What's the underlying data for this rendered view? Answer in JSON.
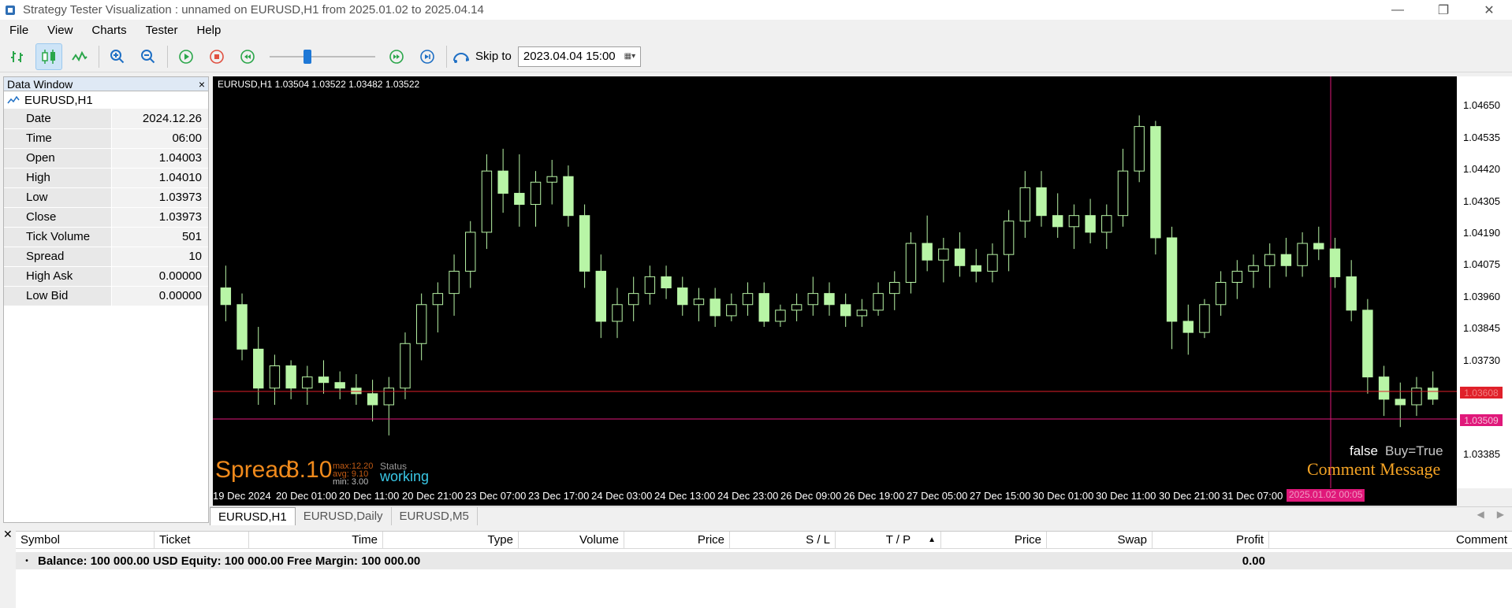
{
  "window": {
    "title": "Strategy Tester Visualization : unnamed on EURUSD,H1 from 2025.01.02 to 2025.04.14",
    "controls": [
      "—",
      "❐",
      "✕"
    ]
  },
  "menu": [
    "File",
    "View",
    "Charts",
    "Tester",
    "Help"
  ],
  "toolbar": {
    "buttons": [
      "bar-chart-icon",
      "candlestick-icon",
      "line-chart-icon",
      "zoom-in-icon",
      "zoom-out-icon",
      "play-icon",
      "stop-icon",
      "rewind-icon",
      "fast-forward-icon",
      "skip-end-icon"
    ],
    "slider_position": 0.35,
    "skip_label": "Skip to",
    "skip_value": "2023.04.04 15:00"
  },
  "data_window": {
    "title": "Data Window",
    "close": "×",
    "symbol": "EURUSD,H1",
    "rows": [
      {
        "k": "Date",
        "v": "2024.12.26"
      },
      {
        "k": "Time",
        "v": "06:00"
      },
      {
        "k": "Open",
        "v": "1.04003"
      },
      {
        "k": "High",
        "v": "1.04010"
      },
      {
        "k": "Low",
        "v": "1.03973"
      },
      {
        "k": "Close",
        "v": "1.03973"
      },
      {
        "k": "Tick Volume",
        "v": "501"
      },
      {
        "k": "Spread",
        "v": "10"
      },
      {
        "k": "High Ask",
        "v": "0.00000"
      },
      {
        "k": "Low Bid",
        "v": "0.00000"
      }
    ]
  },
  "chart": {
    "info": "EURUSD,H1  1.03504 1.03522 1.03482 1.03522",
    "y_ticks": [
      "1.04650",
      "1.04535",
      "1.04420",
      "1.04305",
      "1.04190",
      "1.04075",
      "1.03960",
      "1.03845",
      "1.03730",
      "1.03385"
    ],
    "x_ticks": [
      "19 Dec 2024",
      "20 Dec 01:00",
      "20 Dec 11:00",
      "20 Dec 21:00",
      "23 Dec 07:00",
      "23 Dec 17:00",
      "24 Dec 03:00",
      "24 Dec 13:00",
      "24 Dec 23:00",
      "26 Dec 09:00",
      "26 Dec 19:00",
      "27 Dec 05:00",
      "27 Dec 15:00",
      "30 Dec 01:00",
      "30 Dec 11:00",
      "30 Dec 21:00",
      "31 Dec 07:00"
    ],
    "cursor_time": "2025.01.02 00:05",
    "price_red": "1.03608",
    "price_pink": "1.03509",
    "colors": {
      "bg": "#000000",
      "candle": "#b8f5a6",
      "red_line": "#e0202a",
      "pink": "#e0187a"
    },
    "spread": {
      "label": "Spread",
      "value": "8.10",
      "max": "max:12.20",
      "avg": "avg: 9.10",
      "min": "min: 3.00"
    },
    "status_label": "Status",
    "status_value": "working",
    "buy_false": "false",
    "buy_true": "Buy=True",
    "comment": "Comment Message"
  },
  "chart_data": {
    "type": "candlestick",
    "xlabel": "",
    "ylabel": "",
    "ylim": [
      1.0326,
      1.0474
    ],
    "candles": [
      {
        "o": 1.0398,
        "h": 1.0406,
        "l": 1.0386,
        "c": 1.0392
      },
      {
        "o": 1.0392,
        "h": 1.0396,
        "l": 1.0372,
        "c": 1.0376
      },
      {
        "o": 1.0376,
        "h": 1.0384,
        "l": 1.0356,
        "c": 1.0362
      },
      {
        "o": 1.0362,
        "h": 1.0374,
        "l": 1.0356,
        "c": 1.037
      },
      {
        "o": 1.037,
        "h": 1.0372,
        "l": 1.0358,
        "c": 1.0362
      },
      {
        "o": 1.0362,
        "h": 1.037,
        "l": 1.0356,
        "c": 1.0366
      },
      {
        "o": 1.0366,
        "h": 1.0372,
        "l": 1.036,
        "c": 1.0364
      },
      {
        "o": 1.0364,
        "h": 1.0368,
        "l": 1.0358,
        "c": 1.0362
      },
      {
        "o": 1.0362,
        "h": 1.0367,
        "l": 1.0356,
        "c": 1.036
      },
      {
        "o": 1.036,
        "h": 1.0365,
        "l": 1.035,
        "c": 1.0356
      },
      {
        "o": 1.0356,
        "h": 1.0366,
        "l": 1.0345,
        "c": 1.0362
      },
      {
        "o": 1.0362,
        "h": 1.0382,
        "l": 1.0358,
        "c": 1.0378
      },
      {
        "o": 1.0378,
        "h": 1.0396,
        "l": 1.0372,
        "c": 1.0392
      },
      {
        "o": 1.0392,
        "h": 1.04,
        "l": 1.0382,
        "c": 1.0396
      },
      {
        "o": 1.0396,
        "h": 1.041,
        "l": 1.0388,
        "c": 1.0404
      },
      {
        "o": 1.0404,
        "h": 1.0422,
        "l": 1.0398,
        "c": 1.0418
      },
      {
        "o": 1.0418,
        "h": 1.0446,
        "l": 1.0412,
        "c": 1.044
      },
      {
        "o": 1.044,
        "h": 1.0448,
        "l": 1.0425,
        "c": 1.0432
      },
      {
        "o": 1.0432,
        "h": 1.0446,
        "l": 1.042,
        "c": 1.0428
      },
      {
        "o": 1.0428,
        "h": 1.044,
        "l": 1.042,
        "c": 1.0436
      },
      {
        "o": 1.0436,
        "h": 1.0444,
        "l": 1.0428,
        "c": 1.0438
      },
      {
        "o": 1.0438,
        "h": 1.0442,
        "l": 1.042,
        "c": 1.0424
      },
      {
        "o": 1.0424,
        "h": 1.0428,
        "l": 1.0398,
        "c": 1.0404
      },
      {
        "o": 1.0404,
        "h": 1.041,
        "l": 1.038,
        "c": 1.0386
      },
      {
        "o": 1.0386,
        "h": 1.0398,
        "l": 1.038,
        "c": 1.0392
      },
      {
        "o": 1.0392,
        "h": 1.0402,
        "l": 1.0386,
        "c": 1.0396
      },
      {
        "o": 1.0396,
        "h": 1.0406,
        "l": 1.0392,
        "c": 1.0402
      },
      {
        "o": 1.0402,
        "h": 1.0406,
        "l": 1.0394,
        "c": 1.0398
      },
      {
        "o": 1.0398,
        "h": 1.0402,
        "l": 1.0388,
        "c": 1.0392
      },
      {
        "o": 1.0392,
        "h": 1.0398,
        "l": 1.0386,
        "c": 1.0394
      },
      {
        "o": 1.0394,
        "h": 1.0398,
        "l": 1.0384,
        "c": 1.0388
      },
      {
        "o": 1.0388,
        "h": 1.0396,
        "l": 1.0386,
        "c": 1.0392
      },
      {
        "o": 1.0392,
        "h": 1.04,
        "l": 1.0388,
        "c": 1.0396
      },
      {
        "o": 1.0396,
        "h": 1.04,
        "l": 1.0384,
        "c": 1.0386
      },
      {
        "o": 1.0386,
        "h": 1.0392,
        "l": 1.0384,
        "c": 1.039
      },
      {
        "o": 1.039,
        "h": 1.0396,
        "l": 1.0386,
        "c": 1.0392
      },
      {
        "o": 1.0392,
        "h": 1.0402,
        "l": 1.0388,
        "c": 1.0396
      },
      {
        "o": 1.0396,
        "h": 1.04,
        "l": 1.0388,
        "c": 1.0392
      },
      {
        "o": 1.0392,
        "h": 1.0396,
        "l": 1.0384,
        "c": 1.0388
      },
      {
        "o": 1.0388,
        "h": 1.0394,
        "l": 1.0384,
        "c": 1.039
      },
      {
        "o": 1.039,
        "h": 1.04,
        "l": 1.0388,
        "c": 1.0396
      },
      {
        "o": 1.0396,
        "h": 1.0404,
        "l": 1.039,
        "c": 1.04
      },
      {
        "o": 1.04,
        "h": 1.0418,
        "l": 1.0396,
        "c": 1.0414
      },
      {
        "o": 1.0414,
        "h": 1.0424,
        "l": 1.0404,
        "c": 1.0408
      },
      {
        "o": 1.0408,
        "h": 1.0416,
        "l": 1.04,
        "c": 1.0412
      },
      {
        "o": 1.0412,
        "h": 1.0418,
        "l": 1.0402,
        "c": 1.0406
      },
      {
        "o": 1.0406,
        "h": 1.0412,
        "l": 1.04,
        "c": 1.0404
      },
      {
        "o": 1.0404,
        "h": 1.0414,
        "l": 1.04,
        "c": 1.041
      },
      {
        "o": 1.041,
        "h": 1.0426,
        "l": 1.0404,
        "c": 1.0422
      },
      {
        "o": 1.0422,
        "h": 1.044,
        "l": 1.0416,
        "c": 1.0434
      },
      {
        "o": 1.0434,
        "h": 1.044,
        "l": 1.042,
        "c": 1.0424
      },
      {
        "o": 1.0424,
        "h": 1.0432,
        "l": 1.0416,
        "c": 1.042
      },
      {
        "o": 1.042,
        "h": 1.0428,
        "l": 1.0412,
        "c": 1.0424
      },
      {
        "o": 1.0424,
        "h": 1.043,
        "l": 1.0414,
        "c": 1.0418
      },
      {
        "o": 1.0418,
        "h": 1.0428,
        "l": 1.0412,
        "c": 1.0424
      },
      {
        "o": 1.0424,
        "h": 1.0448,
        "l": 1.042,
        "c": 1.044
      },
      {
        "o": 1.044,
        "h": 1.046,
        "l": 1.0436,
        "c": 1.0456
      },
      {
        "o": 1.0456,
        "h": 1.0458,
        "l": 1.041,
        "c": 1.0416
      },
      {
        "o": 1.0416,
        "h": 1.042,
        "l": 1.0376,
        "c": 1.0386
      },
      {
        "o": 1.0386,
        "h": 1.0392,
        "l": 1.0374,
        "c": 1.0382
      },
      {
        "o": 1.0382,
        "h": 1.0394,
        "l": 1.038,
        "c": 1.0392
      },
      {
        "o": 1.0392,
        "h": 1.0404,
        "l": 1.0388,
        "c": 1.04
      },
      {
        "o": 1.04,
        "h": 1.0408,
        "l": 1.0394,
        "c": 1.0404
      },
      {
        "o": 1.0404,
        "h": 1.041,
        "l": 1.0398,
        "c": 1.0406
      },
      {
        "o": 1.0406,
        "h": 1.0414,
        "l": 1.0398,
        "c": 1.041
      },
      {
        "o": 1.041,
        "h": 1.0416,
        "l": 1.0402,
        "c": 1.0406
      },
      {
        "o": 1.0406,
        "h": 1.0418,
        "l": 1.0402,
        "c": 1.0414
      },
      {
        "o": 1.0414,
        "h": 1.042,
        "l": 1.0408,
        "c": 1.0412
      },
      {
        "o": 1.0412,
        "h": 1.0416,
        "l": 1.0398,
        "c": 1.0402
      },
      {
        "o": 1.0402,
        "h": 1.0408,
        "l": 1.0386,
        "c": 1.039
      },
      {
        "o": 1.039,
        "h": 1.0394,
        "l": 1.036,
        "c": 1.0366
      },
      {
        "o": 1.0366,
        "h": 1.037,
        "l": 1.0352,
        "c": 1.0358
      },
      {
        "o": 1.0358,
        "h": 1.0364,
        "l": 1.0348,
        "c": 1.0356
      },
      {
        "o": 1.0356,
        "h": 1.0366,
        "l": 1.0352,
        "c": 1.0362
      },
      {
        "o": 1.0362,
        "h": 1.0368,
        "l": 1.0356,
        "c": 1.0358
      }
    ]
  },
  "chart_tabs": [
    "EURUSD,H1",
    "EURUSD,Daily",
    "EURUSD,M5"
  ],
  "tabs_nav": [
    "◀",
    "▶"
  ],
  "terminal": {
    "close": "✕",
    "columns": [
      "Symbol",
      "Ticket",
      "Time",
      "Type",
      "Volume",
      "Price",
      "S / L",
      "T / P",
      "Price",
      "Swap",
      "Profit",
      "Comment"
    ],
    "balance": "Balance: 100 000.00 USD  Equity: 100 000.00  Free Margin: 100 000.00",
    "profit": "0.00"
  }
}
